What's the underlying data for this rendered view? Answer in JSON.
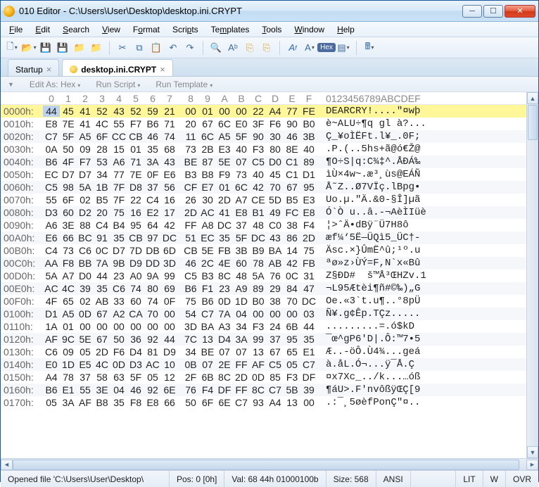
{
  "window": {
    "title": "010 Editor - C:\\Users\\User\\Desktop\\desktop.ini.CRYPT"
  },
  "menu": [
    "File",
    "Edit",
    "Search",
    "View",
    "Format",
    "Scripts",
    "Templates",
    "Tools",
    "Window",
    "Help"
  ],
  "tabs": [
    {
      "label": "Startup",
      "active": false
    },
    {
      "label": "desktop.ini.CRYPT",
      "active": true
    }
  ],
  "subbar": {
    "edit_as": "Edit As: Hex",
    "run_script": "Run Script",
    "run_template": "Run Template"
  },
  "hex": {
    "byte_cols": [
      "0",
      "1",
      "2",
      "3",
      "4",
      "5",
      "6",
      "7",
      "8",
      "9",
      "A",
      "B",
      "C",
      "D",
      "E",
      "F"
    ],
    "asc_header": "0123456789ABCDEF",
    "rows": [
      {
        "off": "0000h:",
        "b": [
          "44",
          "45",
          "41",
          "52",
          "43",
          "52",
          "59",
          "21",
          "00",
          "01",
          "00",
          "00",
          "22",
          "A4",
          "77",
          "FE"
        ],
        "a": "DEARCRY!....\"¤wþ"
      },
      {
        "off": "0010h:",
        "b": [
          "E8",
          "7E",
          "41",
          "4C",
          "55",
          "F7",
          "B6",
          "71",
          "20",
          "67",
          "6C",
          "E0",
          "3F",
          "F6",
          "90",
          "B0"
        ],
        "a": "è~ALU÷¶q gl à?..."
      },
      {
        "off": "0020h:",
        "b": [
          "C7",
          "5F",
          "A5",
          "6F",
          "CC",
          "CB",
          "46",
          "74",
          "11",
          "6C",
          "A5",
          "5F",
          "90",
          "30",
          "46",
          "3B"
        ],
        "a": "Ç_¥oÌËFt.l¥_.0F;"
      },
      {
        "off": "0030h:",
        "b": [
          "0A",
          "50",
          "09",
          "28",
          "15",
          "01",
          "35",
          "68",
          "73",
          "2B",
          "E3",
          "40",
          "F3",
          "80",
          "8E",
          "40"
        ],
        "a": ".P.(..5hs+ã@ó€Ž@"
      },
      {
        "off": "0040h:",
        "b": [
          "B6",
          "4F",
          "F7",
          "53",
          "A6",
          "71",
          "3A",
          "43",
          "BE",
          "87",
          "5E",
          "07",
          "C5",
          "D0",
          "C1",
          "89"
        ],
        "a": "¶O÷S|q:C¾‡^.ÅĐÁ‰"
      },
      {
        "off": "0050h:",
        "b": [
          "EC",
          "D7",
          "D7",
          "34",
          "77",
          "7E",
          "0F",
          "E6",
          "B3",
          "B8",
          "F9",
          "73",
          "40",
          "45",
          "C1",
          "D1"
        ],
        "a": "ìÙ×4w~.æ³¸ùs@EÁÑ"
      },
      {
        "off": "0060h:",
        "b": [
          "C5",
          "98",
          "5A",
          "1B",
          "7F",
          "D8",
          "37",
          "56",
          "CF",
          "E7",
          "01",
          "6C",
          "42",
          "70",
          "67",
          "95"
        ],
        "a": "Å˜Z..Ø7VÏç.lBpg•"
      },
      {
        "off": "0070h:",
        "b": [
          "55",
          "6F",
          "02",
          "B5",
          "7F",
          "22",
          "C4",
          "16",
          "26",
          "30",
          "2D",
          "A7",
          "CE",
          "5D",
          "B5",
          "E3"
        ],
        "a": "Uo.µ.\"Ä.&0-§Î]µã"
      },
      {
        "off": "0080h:",
        "b": [
          "D3",
          "60",
          "D2",
          "20",
          "75",
          "16",
          "E2",
          "17",
          "2D",
          "AC",
          "41",
          "E8",
          "B1",
          "49",
          "FC",
          "E8"
        ],
        "a": "Ó`Ò u..â.-¬AèÌIüè"
      },
      {
        "off": "0090h:",
        "b": [
          "A6",
          "3E",
          "88",
          "C4",
          "B4",
          "95",
          "64",
          "42",
          "FF",
          "A8",
          "DC",
          "37",
          "48",
          "C0",
          "38",
          "F4"
        ],
        "a": "¦>ˆÄ•dBÿ¨Ü7H8ô"
      },
      {
        "off": "00A0h:",
        "b": [
          "E6",
          "66",
          "BC",
          "91",
          "35",
          "CB",
          "97",
          "DC",
          "51",
          "EC",
          "35",
          "5F",
          "DC",
          "43",
          "86",
          "2D"
        ],
        "a": "æf¼‘5Ë—ÜQì5_ÜC†-"
      },
      {
        "off": "00B0h:",
        "b": [
          "C4",
          "73",
          "C6",
          "0C",
          "D7",
          "7D",
          "DB",
          "6D",
          "CB",
          "5E",
          "FB",
          "3B",
          "B9",
          "BA",
          "14",
          "75"
        ],
        "a": "Äsc.×}ÛmË^û;¹º.u"
      },
      {
        "off": "00C0h:",
        "b": [
          "AA",
          "F8",
          "BB",
          "7A",
          "9B",
          "D9",
          "DD",
          "3D",
          "46",
          "2C",
          "4E",
          "60",
          "78",
          "AB",
          "42",
          "FB"
        ],
        "a": "ªø»z›ÙÝ=F,N`x«Bû"
      },
      {
        "off": "00D0h:",
        "b": [
          "5A",
          "A7",
          "D0",
          "44",
          "23",
          "A0",
          "9A",
          "99",
          "C5",
          "B3",
          "8C",
          "48",
          "5A",
          "76",
          "0C",
          "31"
        ],
        "a": "Z§ÐD#  š™Å³ŒHZv.1"
      },
      {
        "off": "00E0h:",
        "b": [
          "AC",
          "4C",
          "39",
          "35",
          "C6",
          "74",
          "80",
          "69",
          "B6",
          "F1",
          "23",
          "A9",
          "89",
          "29",
          "84",
          "47"
        ],
        "a": "¬L95Ætèi¶ñ#©‰)„G"
      },
      {
        "off": "00F0h:",
        "b": [
          "4F",
          "65",
          "02",
          "AB",
          "33",
          "60",
          "74",
          "0F",
          "75",
          "B6",
          "0D",
          "1D",
          "B0",
          "38",
          "70",
          "DC"
        ],
        "a": "Oe.«3`t.u¶..°8pÜ"
      },
      {
        "off": "0100h:",
        "b": [
          "D1",
          "A5",
          "0D",
          "67",
          "A2",
          "CA",
          "70",
          "00",
          "54",
          "C7",
          "7A",
          "04",
          "00",
          "00",
          "00",
          "03"
        ],
        "a": "Ñ¥.g¢Êp.TÇz....."
      },
      {
        "off": "0110h:",
        "b": [
          "1A",
          "01",
          "00",
          "00",
          "00",
          "00",
          "00",
          "00",
          "3D",
          "BA",
          "A3",
          "34",
          "F3",
          "24",
          "6B",
          "44"
        ],
        "a": ".........=.ó$kD"
      },
      {
        "off": "0120h:",
        "b": [
          "AF",
          "9C",
          "5E",
          "67",
          "50",
          "36",
          "92",
          "44",
          "7C",
          "13",
          "D4",
          "3A",
          "99",
          "37",
          "95",
          "35"
        ],
        "a": "¯œ^gP6'D|.Ô:™7•5"
      },
      {
        "off": "0130h:",
        "b": [
          "C6",
          "09",
          "05",
          "2D",
          "F6",
          "D4",
          "81",
          "D9",
          "34",
          "BE",
          "07",
          "07",
          "13",
          "67",
          "65",
          "E1"
        ],
        "a": "Æ..-öÔ.Ù4¾...geá"
      },
      {
        "off": "0140h:",
        "b": [
          "E0",
          "1D",
          "E5",
          "4C",
          "0D",
          "D3",
          "AC",
          "10",
          "0B",
          "07",
          "2E",
          "FF",
          "AF",
          "C5",
          "05",
          "C7"
        ],
        "a": "à.åL.Ó¬...ÿ¯Å.Ç"
      },
      {
        "off": "0150h:",
        "b": [
          "A4",
          "78",
          "37",
          "58",
          "63",
          "5F",
          "05",
          "12",
          "2F",
          "6B",
          "8C",
          "2D",
          "0D",
          "85",
          "F3",
          "DF"
        ],
        "a": "¤x7Xc_../k...…óß"
      },
      {
        "off": "0160h:",
        "b": [
          "B6",
          "E1",
          "55",
          "3E",
          "04",
          "46",
          "92",
          "6E",
          "76",
          "F4",
          "DF",
          "FF",
          "8C",
          "C7",
          "5B",
          "39"
        ],
        "a": "¶áU>.F'nvôßÿŒÇ[9"
      },
      {
        "off": "0170h:",
        "b": [
          "05",
          "3A",
          "AF",
          "B8",
          "35",
          "F8",
          "E8",
          "66",
          "50",
          "6F",
          "6E",
          "C7",
          "93",
          "A4",
          "13",
          "00"
        ],
        "a": ".:¯¸5øèfPonÇ\"¤.."
      }
    ]
  },
  "status": {
    "file": "Opened file 'C:\\Users\\User\\Desktop\\",
    "pos": "Pos: 0 [0h]",
    "val": "Val: 68 44h 01000100b",
    "size": "Size: 568",
    "enc": "ANSI",
    "lit": "LIT",
    "w": "W",
    "ovr": "OVR"
  }
}
